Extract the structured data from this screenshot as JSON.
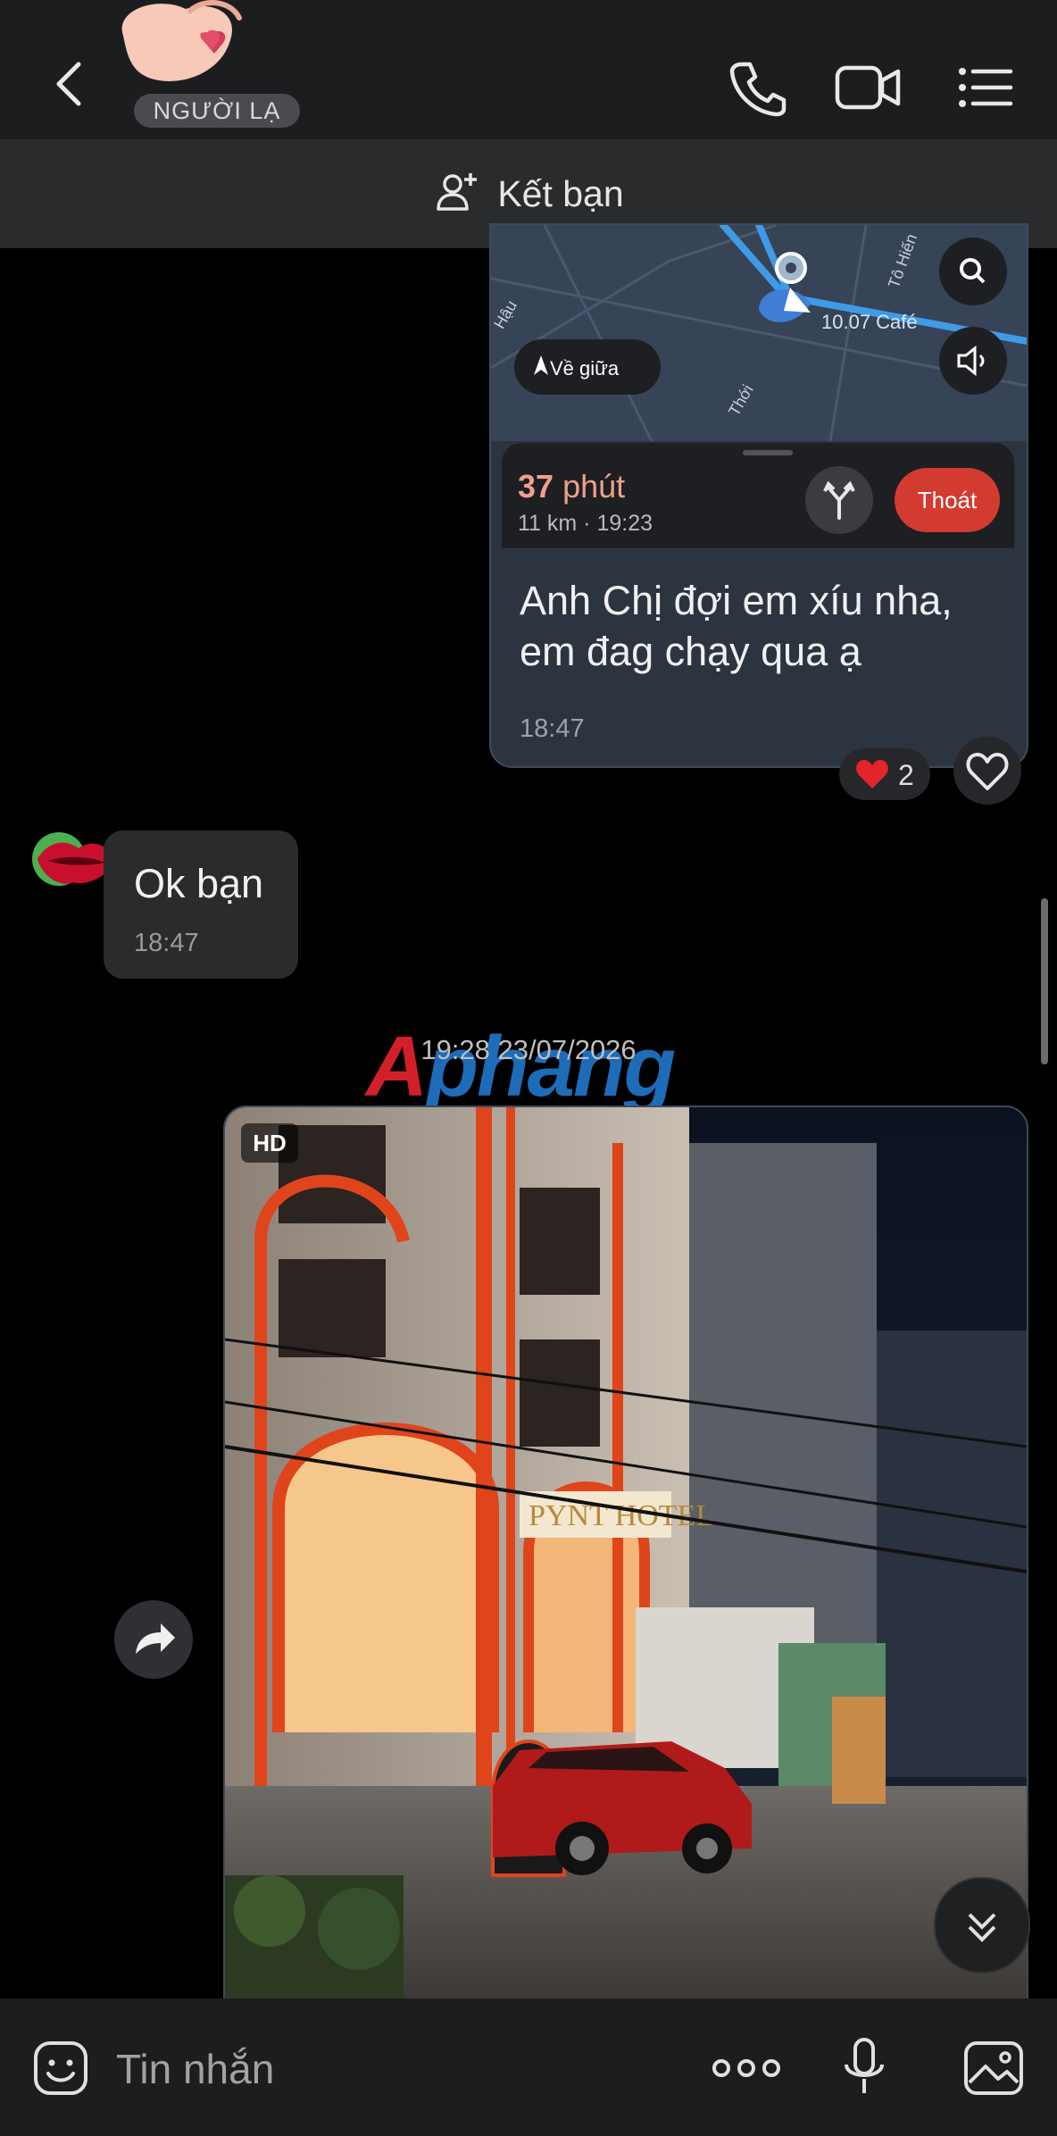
{
  "header": {
    "badge": "NGƯỜI LẠ",
    "icons": [
      "back-arrow-icon",
      "phone-icon",
      "video-camera-icon",
      "list-menu-icon"
    ]
  },
  "add_friend": {
    "label": "Kết bạn",
    "icon": "add-person-icon"
  },
  "map_card": {
    "recenter_label": "Về giữa",
    "place_label": "10.07 Café",
    "street_labels": [
      "Tô Hiến",
      "Hậu",
      "Thới"
    ],
    "eta_value": "37",
    "eta_unit": "phút",
    "eta_detail": "11 km · 19:23",
    "exit_label": "Thoát"
  },
  "messages": {
    "outgoing": {
      "text": "Anh Chị đợi em xíu nha, em đag chạy qua ạ",
      "time": "18:47"
    },
    "reaction": {
      "emoji": "❤️",
      "count": "2"
    },
    "incoming": {
      "text": "Ok bạn",
      "time": "18:47"
    },
    "date_divider": "19:28 23/07/2026",
    "photo": {
      "badge": "HD",
      "sign_text": "PYNT HOTEL"
    }
  },
  "watermark": {
    "part1": "A",
    "part2": "phang"
  },
  "composer": {
    "placeholder": "Tin nhắn"
  },
  "colors": {
    "accent_red": "#d33a30",
    "bubble_out": "#2c3440",
    "bubble_in": "#2a2b2d",
    "header": "#1c1d1f"
  }
}
